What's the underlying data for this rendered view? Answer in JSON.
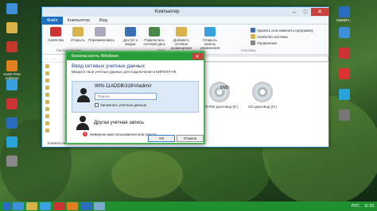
{
  "desktop": {
    "icons_left": [
      {
        "label": "",
        "color": "#3c8fd8"
      },
      {
        "label": "",
        "color": "#d8b24a"
      },
      {
        "label": "",
        "color": "#c23a2e"
      },
      {
        "label": "Avast Free Antivirus",
        "color": "#e07f1f"
      },
      {
        "label": "",
        "color": "#3aa0e0"
      },
      {
        "label": "",
        "color": "#c33"
      },
      {
        "label": "",
        "color": "#2a6cc0"
      },
      {
        "label": "",
        "color": "#2aa3d8"
      },
      {
        "label": "",
        "color": "#888"
      }
    ],
    "icons_right": [
      {
        "label": "КИМИЧ...",
        "color": "#2a6cc0"
      },
      {
        "label": "",
        "color": "#3c8fd8"
      },
      {
        "label": "",
        "color": "#c33"
      },
      {
        "label": "",
        "color": "#d33"
      },
      {
        "label": "",
        "color": "#2aa3d8"
      },
      {
        "label": "",
        "color": "#777"
      }
    ]
  },
  "explorer": {
    "title": "Компьютер",
    "tabs": [
      "Файл",
      "Компьютер",
      "Вид"
    ],
    "ribbon": {
      "buttons": [
        {
          "label": "Свойства",
          "color": "#c33"
        },
        {
          "label": "Открыть",
          "color": "#d8b24a"
        },
        {
          "label": "Переименовать",
          "color": "#aab"
        },
        {
          "label": "Доступ к медиа",
          "color": "#3a6fb8"
        },
        {
          "label": "Подключить сетевой диск",
          "color": "#4a8a4a"
        },
        {
          "label": "Добавить сетевое размещение",
          "color": "#d8b24a"
        },
        {
          "label": "Открыть панель управления",
          "color": "#3aa0e0"
        }
      ],
      "small": [
        "Удалить или изменить программу",
        "Свойства системы",
        "Управление"
      ],
      "groups": [
        "Расположение",
        "Сеть",
        "Система"
      ]
    },
    "address": "Компьютер",
    "nav_items": 10,
    "status_left": "Элементов: 8",
    "drives": [
      {
        "badge": "DVD",
        "label": "DVD RW дисковод (E:)"
      },
      {
        "label": "CD-дисковод (H:)"
      }
    ]
  },
  "dialog": {
    "title": "Безопасность Windows",
    "heading": "Ввод сетевых учетных данных",
    "subtitle": "Введите свои учетные данные для подключения к КИРИЛЛ-ПК",
    "account_name": "WIN-11ADDB\\316\\Vladimir",
    "password_placeholder": "Пароль",
    "remember_label": "Запомнить учетные данные",
    "other_account": "Другая учетная запись",
    "error": "Неверное имя пользователя или пароль.",
    "ok": "ОК",
    "cancel": "Отмена"
  },
  "taskbar": {
    "items": [
      {
        "color": "#3c8fd8"
      },
      {
        "color": "#d8b24a"
      },
      {
        "color": "#3aa0e0"
      },
      {
        "color": "#c33"
      },
      {
        "color": "#e07f1f"
      },
      {
        "color": "#2a6cc0"
      },
      {
        "color": "#7ac"
      }
    ],
    "lang": "РУС",
    "time": "11:29"
  },
  "colors": {
    "accent": "#2b9c3a",
    "ribbon_file": "#1e6fc1",
    "close": "#c8413a"
  }
}
